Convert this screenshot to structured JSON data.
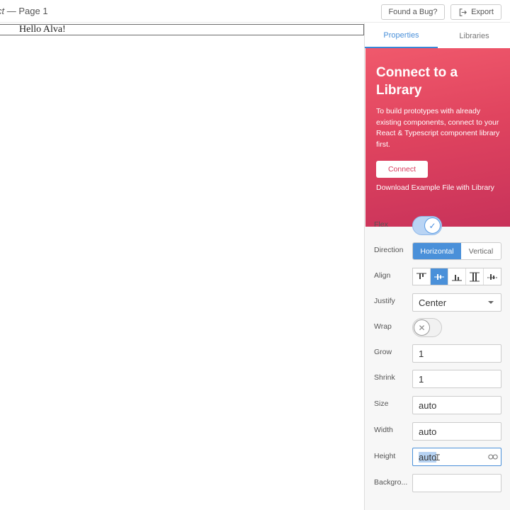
{
  "window": {
    "title_prefix": "ct",
    "title_rest": " — Page 1"
  },
  "toolbar": {
    "bug_label": "Found a Bug?",
    "export_label": "Export"
  },
  "canvas": {
    "hello_text": "Hello Alva!"
  },
  "panel": {
    "tabs": [
      "Properties",
      "Libraries"
    ],
    "promo": {
      "title": "Connect to a Library",
      "text": "To build prototypes with already existing components, connect to your React & Typescript component library first.",
      "connect_label": "Connect",
      "download_label": "Download Example File with Library"
    },
    "properties": {
      "flex_label": "Flex",
      "direction_label": "Direction",
      "direction_options": [
        "Horizontal",
        "Vertical"
      ],
      "direction_selected": "Horizontal",
      "align_label": "Align",
      "justify_label": "Justify",
      "justify_value": "Center",
      "wrap_label": "Wrap",
      "grow_label": "Grow",
      "grow_value": "1",
      "shrink_label": "Shrink",
      "shrink_value": "1",
      "size_label": "Size",
      "size_value": "auto",
      "width_label": "Width",
      "width_value": "auto",
      "height_label": "Height",
      "height_value": "auto",
      "background_label": "Backgro..."
    }
  },
  "colors": {
    "accent": "#4a90d9",
    "promo_start": "#f0596c",
    "promo_end": "#c8325a"
  }
}
